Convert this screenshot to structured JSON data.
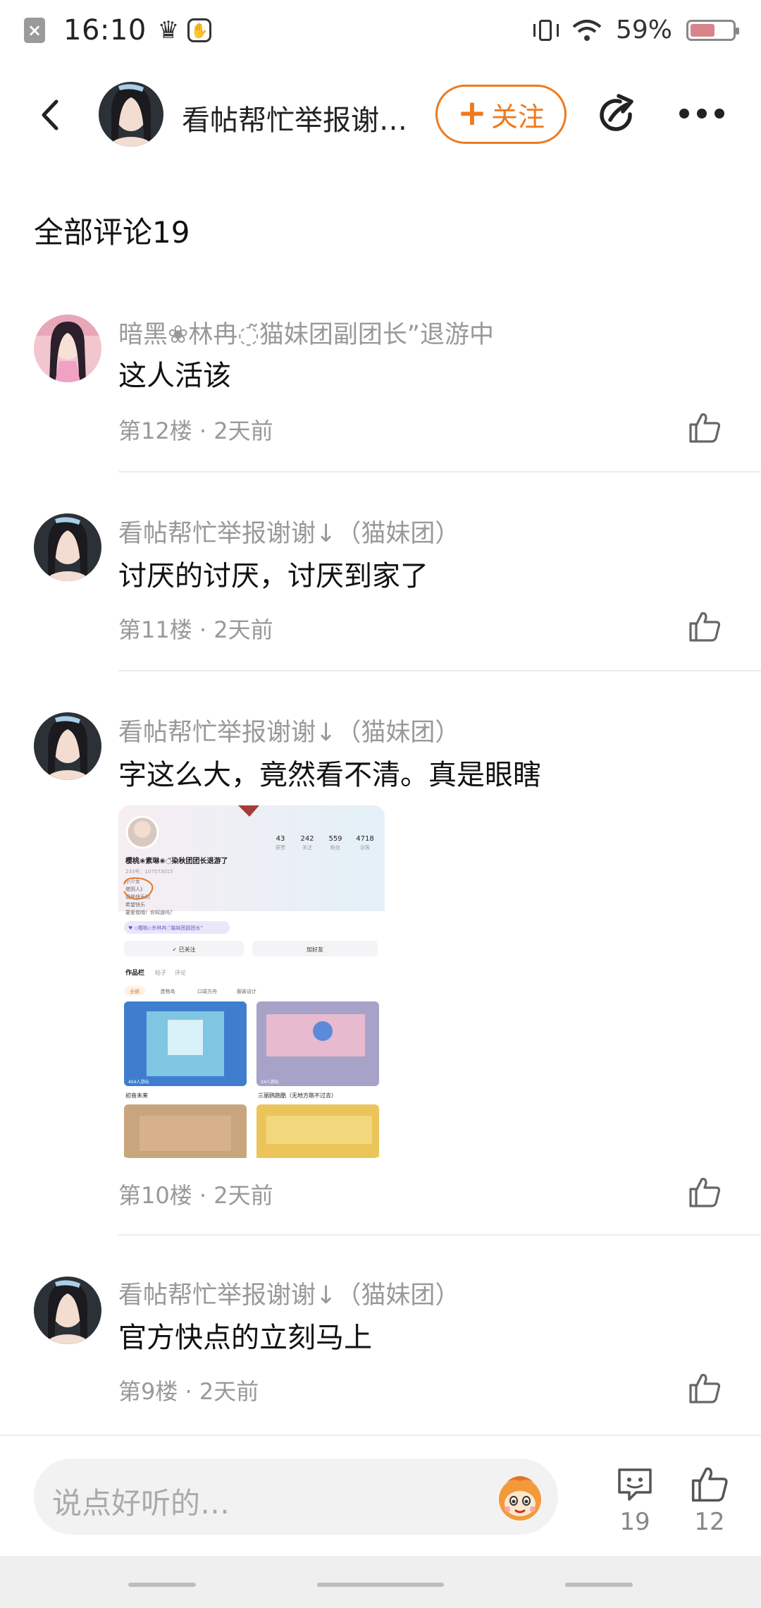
{
  "status_bar": {
    "time": "16:10",
    "notif_glyph": "×",
    "battery_percent_text": "59%",
    "battery_level": 0.59,
    "icons": [
      "close-notification-icon",
      "crown-icon",
      "app-icon",
      "vibrate-icon",
      "wifi-icon",
      "battery-icon"
    ]
  },
  "header": {
    "title": "看帖帮忙举报谢谢↓（猫妹团）",
    "follow_label": "关注",
    "follow_plus": "+",
    "icons": [
      "back-icon",
      "share-icon",
      "more-icon"
    ]
  },
  "section": {
    "title": "全部评论19"
  },
  "comments": [
    {
      "user": "暗黑❀林冉◌̃猫妹团副团长”退游中",
      "text": "这人活该",
      "meta": "第12楼 · 2天前"
    },
    {
      "user": "看帖帮忙举报谢谢↓（猫妹团）",
      "text": "讨厌的讨厌，讨厌到家了",
      "meta": "第11楼 · 2天前"
    },
    {
      "user": "看帖帮忙举报谢谢↓（猫妹团）",
      "text": "字这么大，竟然看不清。真是眼瞎",
      "meta": "第10楼 · 2天前",
      "image": {
        "stats": [
          "43",
          "242",
          "559",
          "4718"
        ],
        "stat_labels": [
          "获赞",
          "关注",
          "粉丝",
          "访客"
        ],
        "profile_name": "樱桃❀素琳❀◌̃染秋团团长退游了",
        "profile_id": "233号：107573015",
        "bio_lines": [
          "小少女",
          "佬阴人》",
          "我是快乐的",
          "希望快乐",
          "要爱我哦！你知道吗？"
        ],
        "badge": "♥ ◇樱桃◇杀林冉◌̃猫妹团副团长”",
        "btn_followed": "✓ 已关注",
        "btn_add_friend": "加好友",
        "tabs": [
          "作品栏",
          "帖子",
          "评论"
        ],
        "filters": [
          "全部",
          "造物岛",
          "口袋方舟",
          "服装设计"
        ],
        "works": [
          {
            "title": "初音未来",
            "plays": "404人游玩"
          },
          {
            "title": "三丽鸥跑酷（无地方跳不过去）",
            "plays": "24人游玩"
          }
        ]
      }
    },
    {
      "user": "看帖帮忙举报谢谢↓（猫妹团）",
      "text": "官方快点的立刻马上",
      "meta": "第9楼 · 2天前"
    }
  ],
  "bottom_bar": {
    "input_placeholder": "说点好听的…",
    "comment_count": "19",
    "like_count": "12"
  },
  "colors": {
    "accent": "#ee7a1f",
    "meta": "#999999",
    "divider": "#ededed"
  }
}
